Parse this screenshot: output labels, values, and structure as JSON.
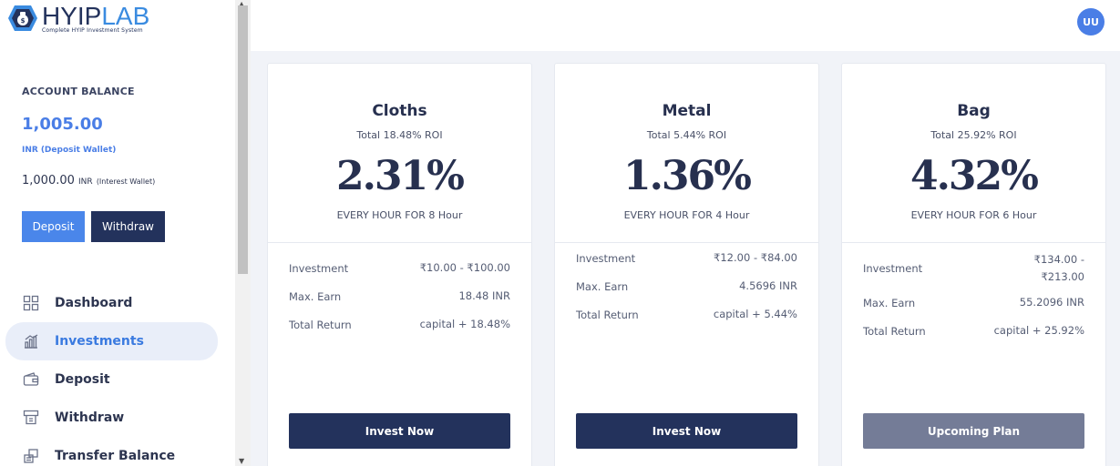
{
  "brand": {
    "name_part1": "HYIP",
    "name_part2": "LAB",
    "tagline": "Complete HYIP Investment System"
  },
  "sidebar": {
    "balance_title": "ACCOUNT BALANCE",
    "deposit_amount": "1,005.00",
    "deposit_unit": "INR",
    "deposit_label": "(Deposit Wallet)",
    "interest_amount": "1,000.00",
    "interest_unit": "INR",
    "interest_label": "(Interest Wallet)",
    "deposit_button": "Deposit",
    "withdraw_button": "Withdraw",
    "nav": [
      {
        "label": "Dashboard",
        "icon": "dashboard-icon"
      },
      {
        "label": "Investments",
        "icon": "investments-icon",
        "active": true
      },
      {
        "label": "Deposit",
        "icon": "wallet-icon"
      },
      {
        "label": "Withdraw",
        "icon": "atm-icon"
      },
      {
        "label": "Transfer Balance",
        "icon": "transfer-icon"
      }
    ]
  },
  "header": {
    "avatar_initials": "UU"
  },
  "plans": [
    {
      "name": "Cloths",
      "total_roi": "Total 18.48% ROI",
      "rate": "2.31%",
      "frequency": "EVERY HOUR FOR 8 Hour",
      "investment_label": "Investment",
      "investment_value": "₹10.00 - ₹100.00",
      "max_earn_label": "Max. Earn",
      "max_earn_value": "18.48 INR",
      "total_return_label": "Total Return",
      "total_return_value": "capital + 18.48%",
      "button": "Invest Now",
      "button_type": "invest"
    },
    {
      "name": "Metal",
      "total_roi": "Total 5.44% ROI",
      "rate": "1.36%",
      "frequency": "EVERY HOUR FOR 4 Hour",
      "investment_label": "Investment",
      "investment_value": "₹12.00 - ₹84.00",
      "max_earn_label": "Max. Earn",
      "max_earn_value": "4.5696 INR",
      "total_return_label": "Total Return",
      "total_return_value": "capital + 5.44%",
      "button": "Invest Now",
      "button_type": "invest"
    },
    {
      "name": "Bag",
      "total_roi": "Total 25.92% ROI",
      "rate": "4.32%",
      "frequency": "EVERY HOUR FOR 6 Hour",
      "investment_label": "Investment",
      "investment_value_line1": "₹134.00 -",
      "investment_value_line2": "₹213.00",
      "max_earn_label": "Max. Earn",
      "max_earn_value": "55.2096 INR",
      "total_return_label": "Total Return",
      "total_return_value": "capital + 25.92%",
      "button": "Upcoming Plan",
      "button_type": "upcoming"
    }
  ],
  "colors": {
    "primary": "#23325c",
    "accent": "#4a7ee6",
    "muted_button": "#747c97"
  }
}
